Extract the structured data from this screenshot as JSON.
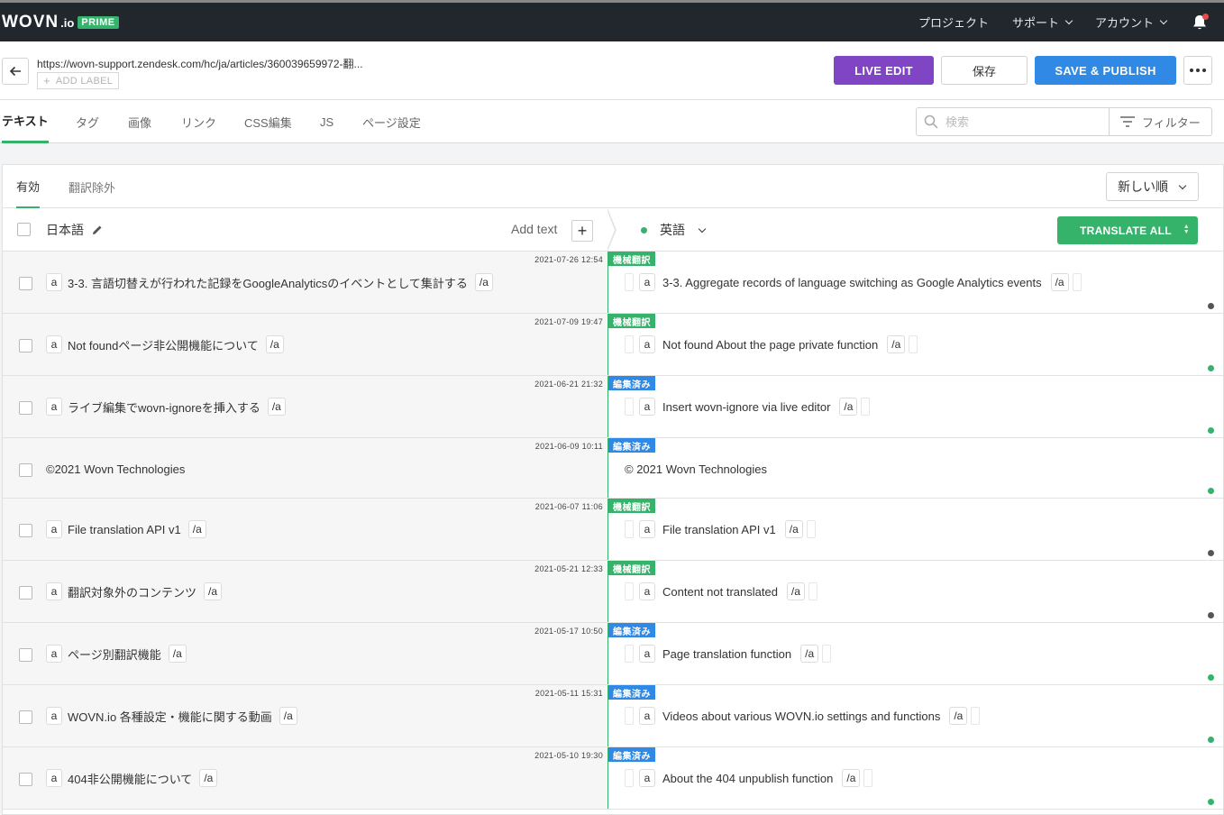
{
  "app": {
    "logo": "WOVN",
    "logo_suffix": ".io",
    "plan_badge": "PRIME"
  },
  "nav": {
    "project": "プロジェクト",
    "support": "サポート",
    "account": "アカウント"
  },
  "page": {
    "url": "https://wovn-support.zendesk.com/hc/ja/articles/360039659972-翻...",
    "add_label": "ADD LABEL",
    "live_edit": "LIVE EDIT",
    "save": "保存",
    "save_publish": "SAVE & PUBLISH"
  },
  "tabs": [
    "テキスト",
    "タグ",
    "画像",
    "リンク",
    "CSS編集",
    "JS",
    "ページ設定"
  ],
  "search": {
    "placeholder": "検索",
    "filter": "フィルター"
  },
  "subtabs": [
    "有効",
    "翻訳除外"
  ],
  "sort": "新しい順",
  "columns": {
    "source_lang": "日本語",
    "add_text": "Add text",
    "target_lang": "英語",
    "translate_all": "TRANSLATE ALL"
  },
  "status_labels": {
    "machine": "機械翻訳",
    "edited": "編集済み"
  },
  "colors": {
    "green": "#35b36b",
    "blue": "#2f89e5",
    "purple": "#8045c4",
    "dark": "#22272d"
  },
  "rows": [
    {
      "timestamp": "2021-07-26 12:54",
      "tag_open": "a",
      "source": "3-3. 言語切替えが行われた記録をGoogleAnalyticsのイベントとして集計する",
      "tag_close": "/a",
      "status": "機械翻訳",
      "target": "3-3. Aggregate records of language switching as Google Analytics events",
      "state": "grey"
    },
    {
      "timestamp": "2021-07-09 19:47",
      "tag_open": "a",
      "source": "Not foundページ非公開機能について",
      "tag_close": "/a",
      "status": "機械翻訳",
      "target": "Not found About the page private function",
      "state": "green"
    },
    {
      "timestamp": "2021-06-21 21:32",
      "tag_open": "a",
      "source": "ライブ編集でwovn-ignoreを挿入する",
      "tag_close": "/a",
      "status": "編集済み",
      "target": "Insert wovn-ignore via live editor",
      "state": "green"
    },
    {
      "timestamp": "2021-06-09 10:11",
      "tag_open": "",
      "source": "©2021 Wovn Technologies",
      "tag_close": "",
      "status": "編集済み",
      "target": "© 2021 Wovn Technologies",
      "state": "green"
    },
    {
      "timestamp": "2021-06-07 11:06",
      "tag_open": "a",
      "source": "File translation API v1",
      "tag_close": "/a",
      "status": "機械翻訳",
      "target": "File translation API v1",
      "state": "grey"
    },
    {
      "timestamp": "2021-05-21 12:33",
      "tag_open": "a",
      "source": "翻訳対象外のコンテンツ",
      "tag_close": "/a",
      "status": "機械翻訳",
      "target": "Content not translated",
      "state": "grey"
    },
    {
      "timestamp": "2021-05-17 10:50",
      "tag_open": "a",
      "source": "ページ別翻訳機能",
      "tag_close": "/a",
      "status": "編集済み",
      "target": "Page translation function",
      "state": "green"
    },
    {
      "timestamp": "2021-05-11 15:31",
      "tag_open": "a",
      "source": "WOVN.io 各種設定・機能に関する動画",
      "tag_close": "/a",
      "status": "編集済み",
      "target": "Videos about various WOVN.io settings and functions",
      "state": "green"
    },
    {
      "timestamp": "2021-05-10 19:30",
      "tag_open": "a",
      "source": "404非公開機能について",
      "tag_close": "/a",
      "status": "編集済み",
      "target": "About the 404 unpublish function",
      "state": "green"
    }
  ]
}
